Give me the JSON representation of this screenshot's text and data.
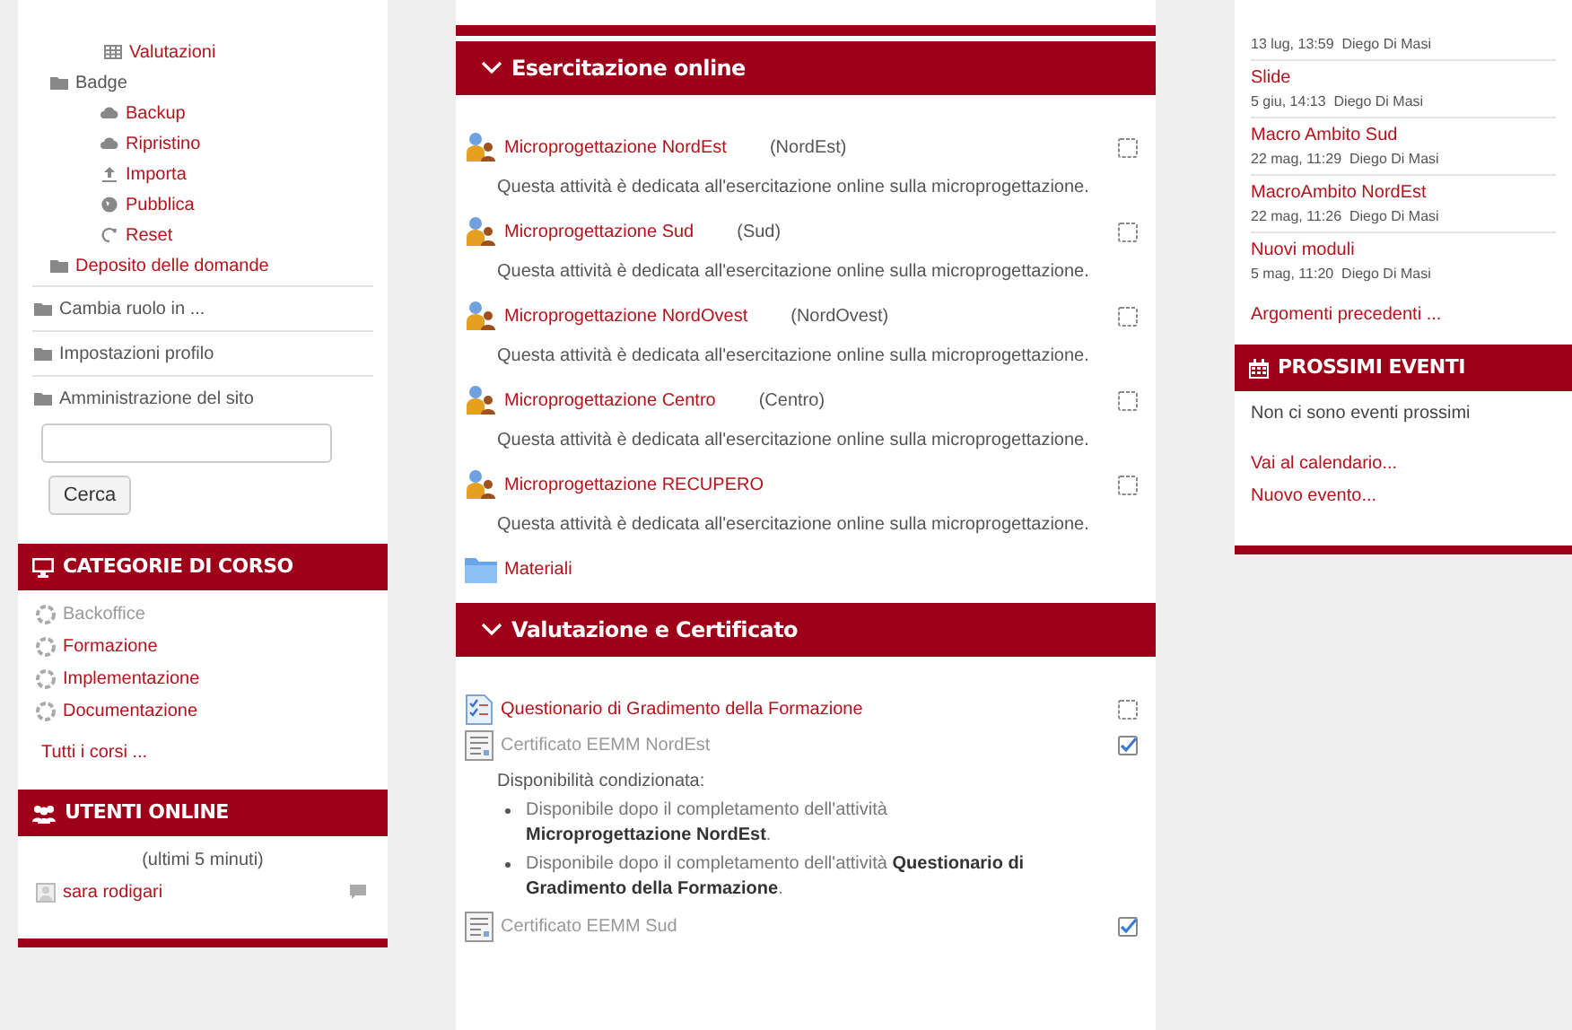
{
  "navigation": {
    "tree": [
      {
        "children": [
          {
            "label": "Valutazioni",
            "kind": "grades"
          }
        ]
      },
      {
        "label": "Badge",
        "kind": "category",
        "children": [
          {
            "label": "Backup",
            "kind": "backup"
          },
          {
            "label": "Ripristino",
            "kind": "restore"
          },
          {
            "label": "Importa",
            "kind": "import"
          },
          {
            "label": "Pubblica",
            "kind": "publish"
          },
          {
            "label": "Reset",
            "kind": "reset"
          }
        ]
      },
      {
        "label": "Deposito delle domande",
        "kind": "question_bank"
      }
    ],
    "sections": [
      "Cambia ruolo in ...",
      "Impostazioni profilo",
      "Amministrazione del sito"
    ],
    "search_button": "Cerca"
  },
  "course_categories": {
    "title": "CATEGORIE DI CORSO",
    "items": [
      {
        "label": "Backoffice",
        "disabled": true
      },
      {
        "label": "Formazione",
        "disabled": false
      },
      {
        "label": "Implementazione",
        "disabled": false
      },
      {
        "label": "Documentazione",
        "disabled": false
      }
    ],
    "all_link": "Tutti i corsi ..."
  },
  "online_users": {
    "title": "UTENTI ONLINE",
    "subtitle": "(ultimi 5 minuti)",
    "users": [
      {
        "name": "sara rodigari"
      }
    ]
  },
  "sections": [
    {
      "title": "Esercitazione online",
      "expanded": true,
      "activities": [
        {
          "kind": "workshop",
          "name": "Microprogettazione NordEst",
          "group": "(NordEst)",
          "description": "Questa attività è dedicata all'esercitazione online sulla microprogettazione.",
          "checked": false,
          "disabled": false
        },
        {
          "kind": "workshop",
          "name": "Microprogettazione Sud",
          "group": "(Sud)",
          "description": "Questa attività è dedicata all'esercitazione online sulla microprogettazione.",
          "checked": false,
          "disabled": false
        },
        {
          "kind": "workshop",
          "name": "Microprogettazione NordOvest",
          "group": "(NordOvest)",
          "description": "Questa attività è dedicata all'esercitazione online sulla microprogettazione.",
          "checked": false,
          "disabled": false
        },
        {
          "kind": "workshop",
          "name": "Microprogettazione Centro",
          "group": "(Centro)",
          "description": "Questa attività è dedicata all'esercitazione online sulla microprogettazione.",
          "checked": false,
          "disabled": false
        },
        {
          "kind": "workshop",
          "name": "Microprogettazione RECUPERO",
          "description": "Questa attività è dedicata all'esercitazione online sulla microprogettazione.",
          "checked": false,
          "disabled": false
        },
        {
          "kind": "folder",
          "name": "Materiali",
          "disabled": false
        }
      ]
    },
    {
      "title": "Valutazione e Certificato",
      "expanded": true,
      "activities": [
        {
          "kind": "feedback",
          "name": "Questionario di Gradimento della Formazione",
          "checked": false,
          "disabled": false
        },
        {
          "kind": "certificate",
          "name": "Certificato EEMM NordEst",
          "checked": true,
          "disabled": true,
          "restriction": {
            "title": "Disponibilità condizionata:",
            "conditions": [
              "Disponibile dopo il completamento dell'attività **Microprogettazione NordEst**.",
              "Disponibile dopo il completamento dell'attività **Questionario di Gradimento della Formazione**."
            ]
          }
        },
        {
          "kind": "certificate",
          "name": "Certificato EEMM Sud",
          "checked": true,
          "disabled": true
        }
      ]
    }
  ],
  "recent_posts": {
    "posts": [
      {
        "meta": "13 lug, 13:59  Diego Di Masi"
      },
      {
        "title": "Slide",
        "meta": "5 giu, 14:13  Diego Di Masi"
      },
      {
        "title": "Macro Ambito Sud",
        "meta": "22 mag, 11:29  Diego Di Masi"
      },
      {
        "title": "MacroAmbito NordEst",
        "meta": "22 mag, 11:26  Diego Di Masi"
      },
      {
        "title": "Nuovi moduli",
        "meta": "5 mag, 11:20  Diego Di Masi"
      }
    ],
    "older_link": "Argomenti precedenti ..."
  },
  "upcoming_events": {
    "title": "PROSSIMI EVENTI",
    "empty_text": "Non ci sono eventi prossimi",
    "links": [
      "Vai al calendario...",
      "Nuovo evento..."
    ]
  }
}
